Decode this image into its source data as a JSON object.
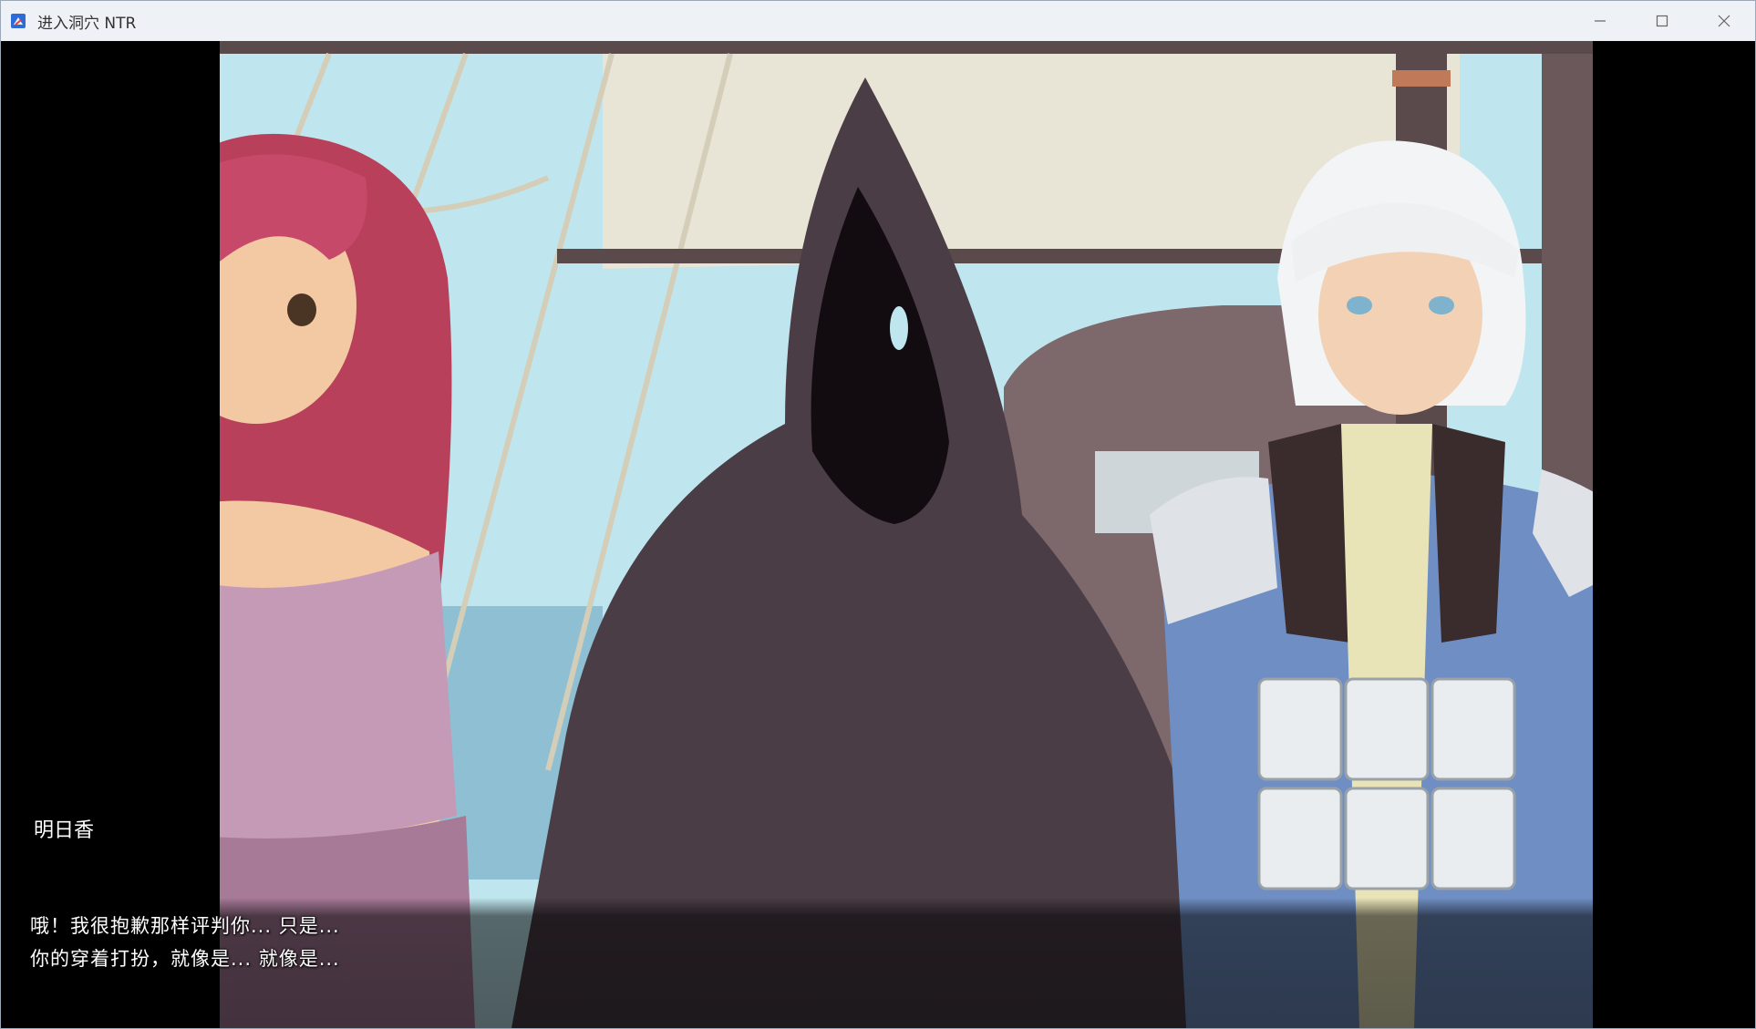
{
  "window": {
    "title": "进入洞穴 NTR",
    "app_icon": "renpy-app-icon",
    "controls": [
      "minimize-icon",
      "maximize-icon",
      "close-icon"
    ]
  },
  "scene": {
    "background": "ship-deck",
    "characters": [
      "red-haired-woman",
      "hooded-figure",
      "white-haired-man"
    ]
  },
  "dialogue": {
    "speaker": "明日香",
    "line1": "哦！我很抱歉那样评判你...  只是...",
    "line2": "你的穿着打扮，就像是...  就像是...",
    "continue_icon": "continue-arrow-icon"
  },
  "colors": {
    "sky": "#bfe6ee",
    "sail": "#e8e4d6",
    "cloak": "#4a3d45",
    "hair_red": "#b8405a",
    "top_pink": "#c59ab7",
    "skin": "#f3c9a4",
    "armor": "#dfe3e7",
    "shirt_blue": "#6f8fc4"
  }
}
